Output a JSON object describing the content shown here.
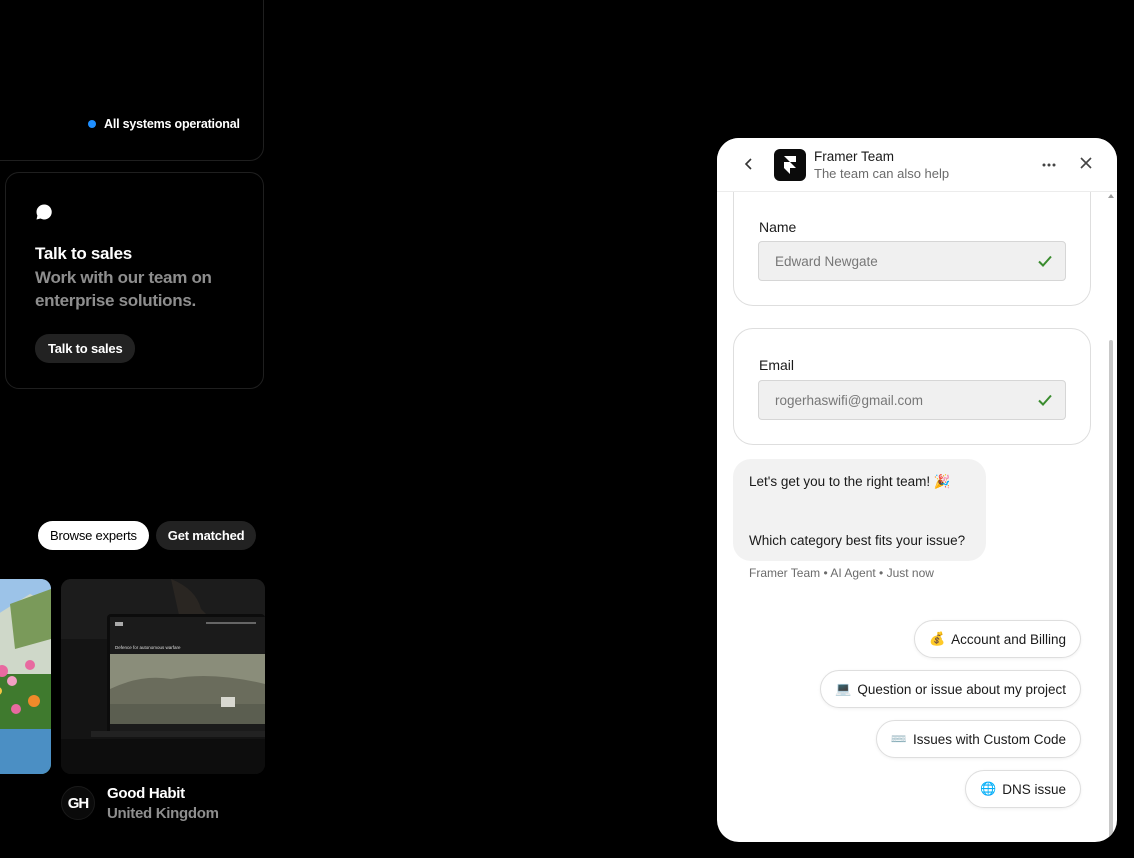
{
  "status": {
    "text": "All systems operational",
    "dot_color": "#1f8fff"
  },
  "sales": {
    "icon": "chat-bubble-icon",
    "title": "Talk to sales",
    "subtitle": "Work with our team on enterprise solutions.",
    "button_label": "Talk to sales"
  },
  "experts": {
    "browse_label": "Browse experts",
    "matched_label": "Get matched"
  },
  "showcase": {
    "mock_headline": "Defence for autonomous warfare",
    "logo_text": "GH",
    "name": "Good Habit",
    "location": "United Kingdom"
  },
  "chat": {
    "header": {
      "title": "Framer Team",
      "subtitle": "The team can also help"
    },
    "name_field": {
      "label": "Name",
      "value": "Edward Newgate"
    },
    "email_field": {
      "label": "Email",
      "value": "rogerhaswifi@gmail.com"
    },
    "message": {
      "line1": "Let's get you to the right team! 🎉",
      "line2": "Which category best fits your issue?",
      "meta": "Framer Team • AI Agent • Just now"
    },
    "options": [
      {
        "emoji": "💰",
        "label": "Account and Billing"
      },
      {
        "emoji": "💻",
        "label": "Question or issue about my project"
      },
      {
        "emoji": "⌨️",
        "label": "Issues with Custom Code"
      },
      {
        "emoji": "🌐",
        "label": "DNS issue"
      }
    ],
    "check_color": "#3a8c2e"
  }
}
